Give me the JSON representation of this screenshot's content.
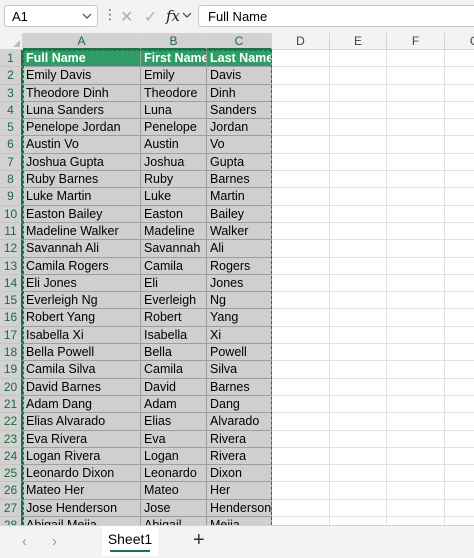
{
  "formula_bar": {
    "name_box": "A1",
    "fx_label": "fx",
    "cancel_glyph": "✕",
    "enter_glyph": "✓",
    "formula": "Full Name"
  },
  "columns": [
    "A",
    "B",
    "C",
    "D",
    "E",
    "F",
    "G"
  ],
  "row_numbers": [
    "1",
    "2",
    "3",
    "4",
    "5",
    "6",
    "7",
    "8",
    "9",
    "10",
    "11",
    "12",
    "13",
    "14",
    "15",
    "16",
    "17",
    "18",
    "19",
    "20",
    "21",
    "22",
    "23",
    "24",
    "25",
    "26",
    "27",
    "28"
  ],
  "table": {
    "headers": [
      "Full Name",
      "First Name",
      "Last Name"
    ],
    "rows": [
      [
        "Emily Davis",
        "Emily",
        "Davis"
      ],
      [
        "Theodore Dinh",
        "Theodore",
        "Dinh"
      ],
      [
        "Luna Sanders",
        "Luna",
        "Sanders"
      ],
      [
        "Penelope Jordan",
        "Penelope",
        "Jordan"
      ],
      [
        "Austin Vo",
        "Austin",
        "Vo"
      ],
      [
        "Joshua Gupta",
        "Joshua",
        "Gupta"
      ],
      [
        "Ruby Barnes",
        "Ruby",
        "Barnes"
      ],
      [
        "Luke Martin",
        "Luke",
        "Martin"
      ],
      [
        "Easton Bailey",
        "Easton",
        "Bailey"
      ],
      [
        "Madeline Walker",
        "Madeline",
        "Walker"
      ],
      [
        "Savannah Ali",
        "Savannah",
        "Ali"
      ],
      [
        "Camila Rogers",
        "Camila",
        "Rogers"
      ],
      [
        "Eli Jones",
        "Eli",
        "Jones"
      ],
      [
        "Everleigh Ng",
        "Everleigh",
        "Ng"
      ],
      [
        "Robert Yang",
        "Robert",
        "Yang"
      ],
      [
        "Isabella Xi",
        "Isabella",
        "Xi"
      ],
      [
        "Bella Powell",
        "Bella",
        "Powell"
      ],
      [
        "Camila Silva",
        "Camila",
        "Silva"
      ],
      [
        "David Barnes",
        "David",
        "Barnes"
      ],
      [
        "Adam Dang",
        "Adam",
        "Dang"
      ],
      [
        "Elias Alvarado",
        "Elias",
        "Alvarado"
      ],
      [
        "Eva Rivera",
        "Eva",
        "Rivera"
      ],
      [
        "Logan Rivera",
        "Logan",
        "Rivera"
      ],
      [
        "Leonardo Dixon",
        "Leonardo",
        "Dixon"
      ],
      [
        "Mateo Her",
        "Mateo",
        "Her"
      ],
      [
        "Jose Henderson",
        "Jose",
        "Henderson"
      ],
      [
        "Abigail Mejia",
        "Abigail",
        "Mejia"
      ]
    ]
  },
  "sheet_tabs": [
    "Sheet1"
  ],
  "icons": {
    "prev": "‹",
    "next": "›",
    "add": "+"
  },
  "colors": {
    "header_fill": "#2f9d67",
    "selection_fill": "#cfcfcf",
    "accent": "#1e7145"
  }
}
